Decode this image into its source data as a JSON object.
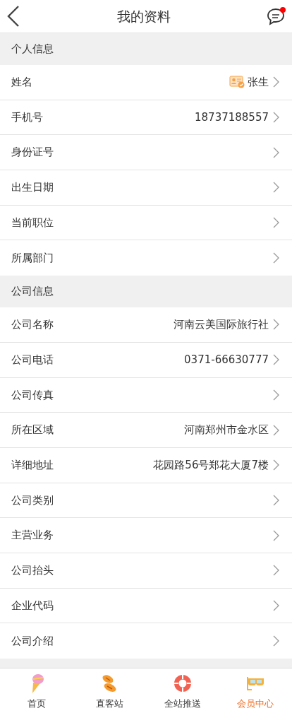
{
  "header": {
    "title": "我的资料",
    "has_unread": true
  },
  "sections": [
    {
      "title": "个人信息",
      "rows": [
        {
          "label": "姓名",
          "value": "张生",
          "kind": "verified"
        },
        {
          "label": "手机号",
          "value": "18737188557",
          "kind": "plain"
        },
        {
          "label": "身份证号",
          "kind": "plain"
        },
        {
          "label": "出生日期",
          "kind": "plain"
        },
        {
          "label": "当前职位",
          "kind": "plain"
        },
        {
          "label": "所属部门",
          "kind": "plain"
        }
      ]
    },
    {
      "title": "公司信息",
      "rows": [
        {
          "label": "公司名称",
          "value": "河南云美国际旅行社",
          "kind": "plain"
        },
        {
          "label": "公司电话",
          "value": "0371-66630777",
          "kind": "plain"
        },
        {
          "label": "公司传真",
          "kind": "plain"
        },
        {
          "label": "所在区域",
          "value": "河南郑州市金水区",
          "kind": "plain"
        },
        {
          "label": "详细地址",
          "value": "花园路56号郑花大厦7楼",
          "kind": "plain"
        },
        {
          "label": "公司类别",
          "kind": "plain"
        },
        {
          "label": "主营业务",
          "kind": "plain"
        },
        {
          "label": "公司抬头",
          "kind": "plain"
        },
        {
          "label": "企业代码",
          "kind": "plain"
        },
        {
          "label": "公司介绍",
          "kind": "plain"
        }
      ]
    }
  ],
  "tabs": [
    {
      "label": "首页",
      "kind": "ice-cream",
      "selected": false
    },
    {
      "label": "直客站",
      "kind": "flip-flops",
      "selected": false
    },
    {
      "label": "全站推送",
      "kind": "lifebuoy",
      "selected": false
    },
    {
      "label": "会员中心",
      "kind": "goggles",
      "selected": true
    }
  ]
}
